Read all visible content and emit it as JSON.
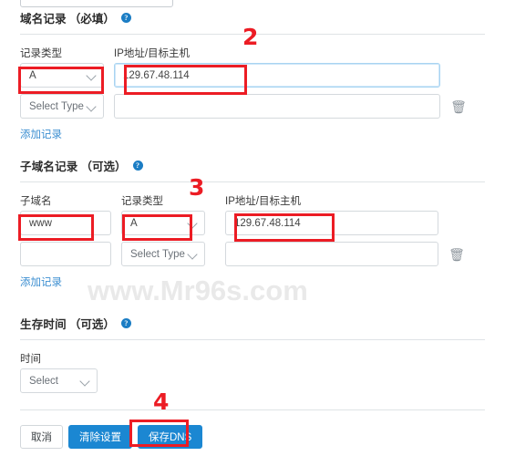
{
  "watermark": "www.Mr96s.com",
  "top_select": {
    "value": ""
  },
  "sections": {
    "domain": {
      "title": "域名记录",
      "optional": "（必填）",
      "help_icon": "?",
      "columns": {
        "type": "记录类型",
        "ip": "IP地址/目标主机"
      },
      "rows": [
        {
          "type": "A",
          "ip": "129.67.48.114"
        },
        {
          "type": "Select Type",
          "ip": ""
        }
      ],
      "add_link": "添加记录"
    },
    "subdomain": {
      "title": "子域名记录",
      "optional": "（可选）",
      "help_icon": "?",
      "columns": {
        "sub": "子域名",
        "type": "记录类型",
        "ip": "IP地址/目标主机"
      },
      "rows": [
        {
          "sub": "www",
          "type": "A",
          "ip": "129.67.48.114"
        },
        {
          "sub": "",
          "type": "Select Type",
          "ip": ""
        }
      ],
      "add_link": "添加记录"
    },
    "ttl": {
      "title": "生存时间",
      "optional": "（可选）",
      "help_icon": "?",
      "label": "时间",
      "select_value": "Select"
    }
  },
  "actions": {
    "cancel": "取消",
    "clear": "清除设置",
    "save": "保存DNS"
  },
  "annotations": {
    "step2": "2",
    "step3": "3",
    "step4": "4"
  },
  "colors": {
    "accent_blue": "#1b87d2",
    "annotation_red": "#ec1c24",
    "link_blue": "#3d8fd1",
    "watermark_gray": "#e9e9e9"
  },
  "icons": {
    "trash": "🗑",
    "chevron_down": "chevron-down"
  }
}
